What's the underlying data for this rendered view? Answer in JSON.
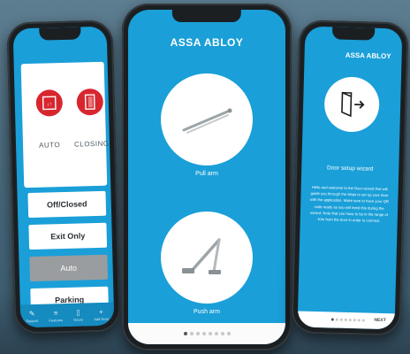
{
  "left_phone": {
    "modes": [
      {
        "label": "AUTO",
        "icon": "auto-mode-icon"
      },
      {
        "label": "CLOSING",
        "icon": "closing-door-icon"
      }
    ],
    "menu": [
      {
        "label": "Off/Closed",
        "selected": false
      },
      {
        "label": "Exit Only",
        "selected": false
      },
      {
        "label": "Auto",
        "selected": true
      },
      {
        "label": "Parking",
        "selected": false
      }
    ],
    "tabs": [
      {
        "label": "Support",
        "icon": "wrench-icon"
      },
      {
        "label": "Features",
        "icon": "sliders-icon"
      },
      {
        "label": "Doors",
        "icon": "phone-icon"
      },
      {
        "label": "Add Door",
        "icon": "plus-icon"
      }
    ]
  },
  "center_phone": {
    "brand": "ASSA ABLOY",
    "options": [
      {
        "label": "Pull arm",
        "icon": "pull-arm-icon"
      },
      {
        "label": "Push arm",
        "icon": "push-arm-icon"
      }
    ],
    "pager": {
      "count": 8,
      "active": 0
    }
  },
  "right_phone": {
    "brand": "ASSA ABLOY",
    "title": "Door setup wizard",
    "body": "Hello and welcome to the Door wizard that will guide you through the steps to set up your door with the application. Make sure to have your QR code ready as you will need this during the wizard. Note that you have to be in the range of 10m from the door in order to connect.",
    "next_label": "NEXT",
    "pager": {
      "count": 8,
      "active": 0
    }
  },
  "colors": {
    "accent": "#1a9fd8",
    "alert_red": "#d8262f",
    "selected_gray": "#9a9d9f"
  }
}
